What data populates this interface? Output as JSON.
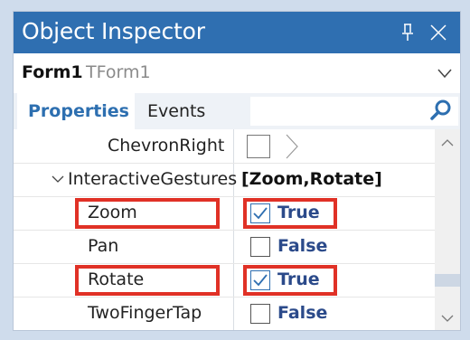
{
  "window": {
    "title": "Object Inspector"
  },
  "form_selector": {
    "name": "Form1",
    "type": "TForm1"
  },
  "tabs": {
    "properties": "Properties",
    "events": "Events"
  },
  "properties": [
    {
      "name": "ChevronRight",
      "value_kind": "checkbox-chevron",
      "checked": false
    },
    {
      "name": "InteractiveGestures",
      "value": "[Zoom,Rotate]",
      "expanded": true
    },
    {
      "name": "Zoom",
      "value": "True",
      "checked": true,
      "highlighted": true
    },
    {
      "name": "Pan",
      "value": "False",
      "checked": false
    },
    {
      "name": "Rotate",
      "value": "True",
      "checked": true,
      "highlighted": true
    },
    {
      "name": "TwoFingerTap",
      "value": "False",
      "checked": false
    }
  ],
  "colors": {
    "titlebar": "#2f6fb1",
    "accent_tab": "#2d6fb0",
    "bool_text": "#2b4a8a",
    "highlight_box": "#e03126"
  },
  "icons": [
    "pin-icon",
    "close-icon",
    "chevron-down-icon",
    "search-icon",
    "expander-icon",
    "scroll-up-icon",
    "scroll-down-icon",
    "checkmark-icon",
    "chevron-right-icon"
  ]
}
